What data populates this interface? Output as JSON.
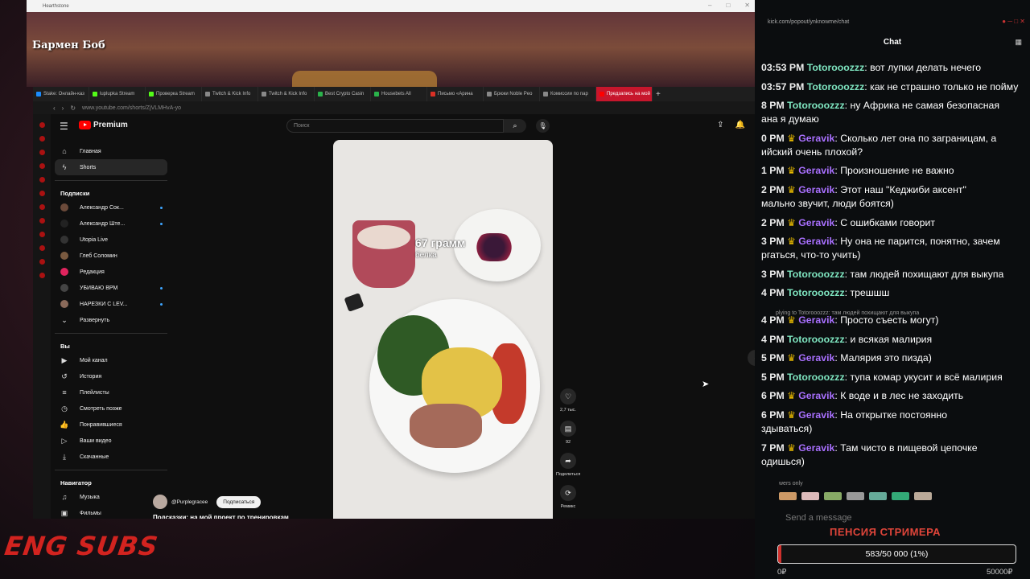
{
  "game": {
    "window_title": "Hearthstone",
    "heading": "Бармен Боб"
  },
  "browser": {
    "tabs": [
      {
        "label": "Stake: Онлайн-каз",
        "color": "#1a8cff"
      },
      {
        "label": "luplupka Stream",
        "color": "#53fc18"
      },
      {
        "label": "Проверка Stream",
        "color": "#53fc18"
      },
      {
        "label": "Twitch & Kick Info",
        "color": "#888888"
      },
      {
        "label": "Twitch & Kick Info",
        "color": "#888888"
      },
      {
        "label": "Best Crypto Casin",
        "color": "#2ab34b"
      },
      {
        "label": "Housebets All",
        "color": "#2ab34b"
      },
      {
        "label": "Письмо «Арина",
        "color": "#d93025"
      },
      {
        "label": "Брюки Noble Peo",
        "color": "#888888"
      },
      {
        "label": "Комиссии по пар",
        "color": "#888888"
      },
      {
        "label": "Предзапись на мой пр",
        "color": "#ff0000",
        "active": true
      }
    ],
    "url": "www.youtube.com/shorts/ZjVLMHvA-yo"
  },
  "youtube": {
    "logo_label": "Premium",
    "search_placeholder": "Поиск",
    "sidebar_main": [
      {
        "label": "Главная",
        "icon": "home-icon"
      },
      {
        "label": "Shorts",
        "icon": "shorts-icon",
        "active": true
      }
    ],
    "subs_heading": "Подписки",
    "subscriptions": [
      {
        "label": "Александр Сок...",
        "color": "#6b4a3a",
        "dot": true
      },
      {
        "label": "Александр Ште...",
        "color": "#222222",
        "dot": true
      },
      {
        "label": "Utopia Live",
        "color": "#333333",
        "dot": false
      },
      {
        "label": "Глеб Соломин",
        "color": "#7a5a40",
        "dot": false
      },
      {
        "label": "Редакция",
        "color": "#e0245e",
        "dot": false
      },
      {
        "label": "УБИВАЮ BPM",
        "color": "#444444",
        "dot": true
      },
      {
        "label": "НАРЕЗКИ С LEV...",
        "color": "#8a6a5a",
        "dot": true
      },
      {
        "label": "Развернуть",
        "color": "",
        "dot": false
      }
    ],
    "you_heading": "Вы",
    "you_items": [
      "Мой канал",
      "История",
      "Плейлисты",
      "Смотреть позже",
      "Понравившиеся",
      "Ваши видео",
      "Скачанные"
    ],
    "nav_heading": "Навигатор",
    "nav_items": [
      "Музыка",
      "Фильмы"
    ],
    "short": {
      "overlay_line1": "67 грамм",
      "overlay_line2": "белка",
      "likes": "2,7 тыс.",
      "comments": "92",
      "share": "Поделиться",
      "remix": "Ремикс",
      "channel": "@Purplegracee",
      "subscribe": "Подписаться",
      "description": "Подсказки: на мой проект по тренировкам"
    }
  },
  "chat": {
    "url": "kick.com/popout/ynknowme/chat",
    "title": "Chat",
    "messages": [
      {
        "time": "03:53 PM",
        "user": "Totorooozzz",
        "color": "#7fe6c1",
        "crown": false,
        "text": "вот лупки делать нечего"
      },
      {
        "time": "03:57 PM",
        "user": "Totorooozzz",
        "color": "#7fe6c1",
        "crown": false,
        "text": "как не страшно только не пойму"
      },
      {
        "time": "8 PM",
        "user": "Totorooozzz",
        "color": "#7fe6c1",
        "crown": false,
        "text": "ну Африка не самая безопасная"
      },
      {
        "time": "",
        "user": "",
        "color": "",
        "crown": false,
        "text": "ана я думаю"
      },
      {
        "time": "0 PM",
        "user": "Geravik",
        "color": "#a970ff",
        "crown": true,
        "text": "Сколько лет она по заграницам, а"
      },
      {
        "time": "",
        "user": "",
        "color": "",
        "crown": false,
        "text": "ийский очень плохой?"
      },
      {
        "time": "1 PM",
        "user": "Geravik",
        "color": "#a970ff",
        "crown": true,
        "text": "Произношение не важно"
      },
      {
        "time": "2 PM",
        "user": "Geravik",
        "color": "#a970ff",
        "crown": true,
        "text": "Этот наш \"Кеджиби аксент\""
      },
      {
        "time": "",
        "user": "",
        "color": "",
        "crown": false,
        "text": "мально звучит, люди боятся)"
      },
      {
        "time": "2 PM",
        "user": "Geravik",
        "color": "#a970ff",
        "crown": true,
        "text": "С ошибками говорит"
      },
      {
        "time": "3 PM",
        "user": "Geravik",
        "color": "#a970ff",
        "crown": true,
        "text": "Ну она не парится, понятно, зачем"
      },
      {
        "time": "",
        "user": "",
        "color": "",
        "crown": false,
        "text": "ргаться, что-то учить)"
      },
      {
        "time": "3 PM",
        "user": "Totorooozzz",
        "color": "#7fe6c1",
        "crown": false,
        "text": "там людей похищают для выкупа"
      },
      {
        "time": "4 PM",
        "user": "Totorooozzz",
        "color": "#7fe6c1",
        "crown": false,
        "text": "трешшш"
      },
      {
        "time": "4 PM",
        "user": "Geravik",
        "color": "#a970ff",
        "crown": true,
        "text": "Просто съесть могут)"
      },
      {
        "time": "4 PM",
        "user": "Totorooozzz",
        "color": "#7fe6c1",
        "crown": false,
        "text": "и всякая малирия"
      },
      {
        "time": "5 PM",
        "user": "Geravik",
        "color": "#a970ff",
        "crown": true,
        "text": "Малярия это пизда)"
      },
      {
        "time": "5 PM",
        "user": "Totorooozzz",
        "color": "#7fe6c1",
        "crown": false,
        "text": "тупа комар укусит и всё малирия"
      },
      {
        "time": "6 PM",
        "user": "Geravik",
        "color": "#a970ff",
        "crown": true,
        "text": "К воде и в лес не заходить"
      },
      {
        "time": "6 PM",
        "user": "Geravik",
        "color": "#a970ff",
        "crown": true,
        "text": "На открытке постоянно"
      },
      {
        "time": "",
        "user": "",
        "color": "",
        "crown": false,
        "text": "здываться)"
      },
      {
        "time": "7 PM",
        "user": "Geravik",
        "color": "#a970ff",
        "crown": true,
        "text": "Там чисто в пищевой цепочке"
      },
      {
        "time": "",
        "user": "",
        "color": "",
        "crown": false,
        "text": "одишься)"
      }
    ],
    "reply_text": "plying to Totorooozzz: там людей похищают для выкупа",
    "followers_only": "wers only",
    "send_placeholder": "Send a message"
  },
  "pension": {
    "title": "ПЕНСИЯ СТРИМЕРА",
    "progress_text": "583/50 000 (1%)",
    "progress_fraction": 0.012,
    "min": "0₽",
    "max": "50000₽"
  },
  "overlay": {
    "subs_label": "ENG SUBS"
  }
}
